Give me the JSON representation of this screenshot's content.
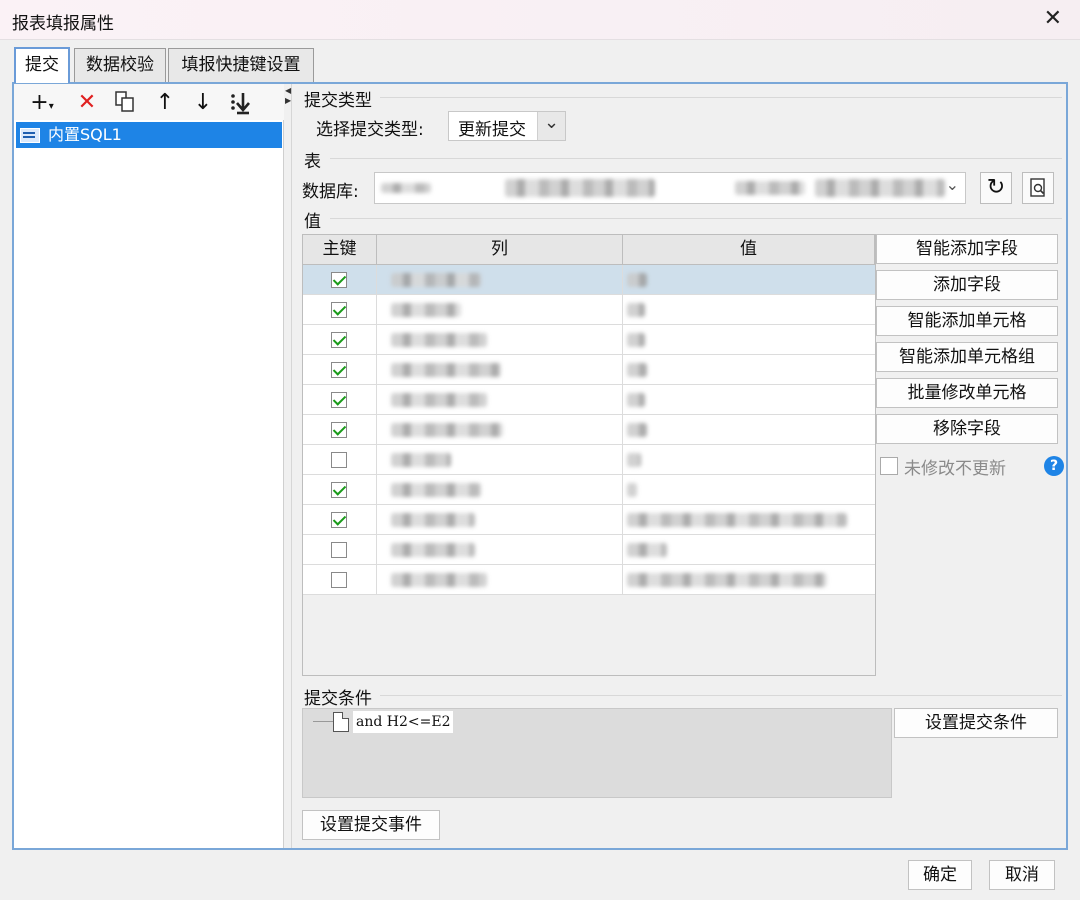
{
  "window": {
    "title": "报表填报属性"
  },
  "tabs": [
    {
      "label": "提交"
    },
    {
      "label": "数据校验"
    },
    {
      "label": "填报快捷键设置"
    }
  ],
  "left": {
    "tree_item": "内置SQL1"
  },
  "submit_type": {
    "section": "提交类型",
    "label": "选择提交类型:",
    "value": "更新提交"
  },
  "table": {
    "section": "表",
    "db_label": "数据库:"
  },
  "values": {
    "section": "值",
    "headers": [
      "主键",
      "列",
      "值"
    ],
    "rows": [
      {
        "key": true
      },
      {
        "key": true
      },
      {
        "key": true
      },
      {
        "key": true
      },
      {
        "key": true
      },
      {
        "key": true
      },
      {
        "key": false
      },
      {
        "key": true
      },
      {
        "key": true
      },
      {
        "key": false
      },
      {
        "key": false
      }
    ]
  },
  "side_buttons": [
    "智能添加字段",
    "添加字段",
    "智能添加单元格",
    "智能添加单元格组",
    "批量修改单元格",
    "移除字段"
  ],
  "no_update_unmodified": "未修改不更新",
  "condition": {
    "section": "提交条件",
    "text": "and H2<=E2",
    "button": "设置提交条件"
  },
  "event_button": "设置提交事件",
  "footer": {
    "ok": "确定",
    "cancel": "取消"
  }
}
